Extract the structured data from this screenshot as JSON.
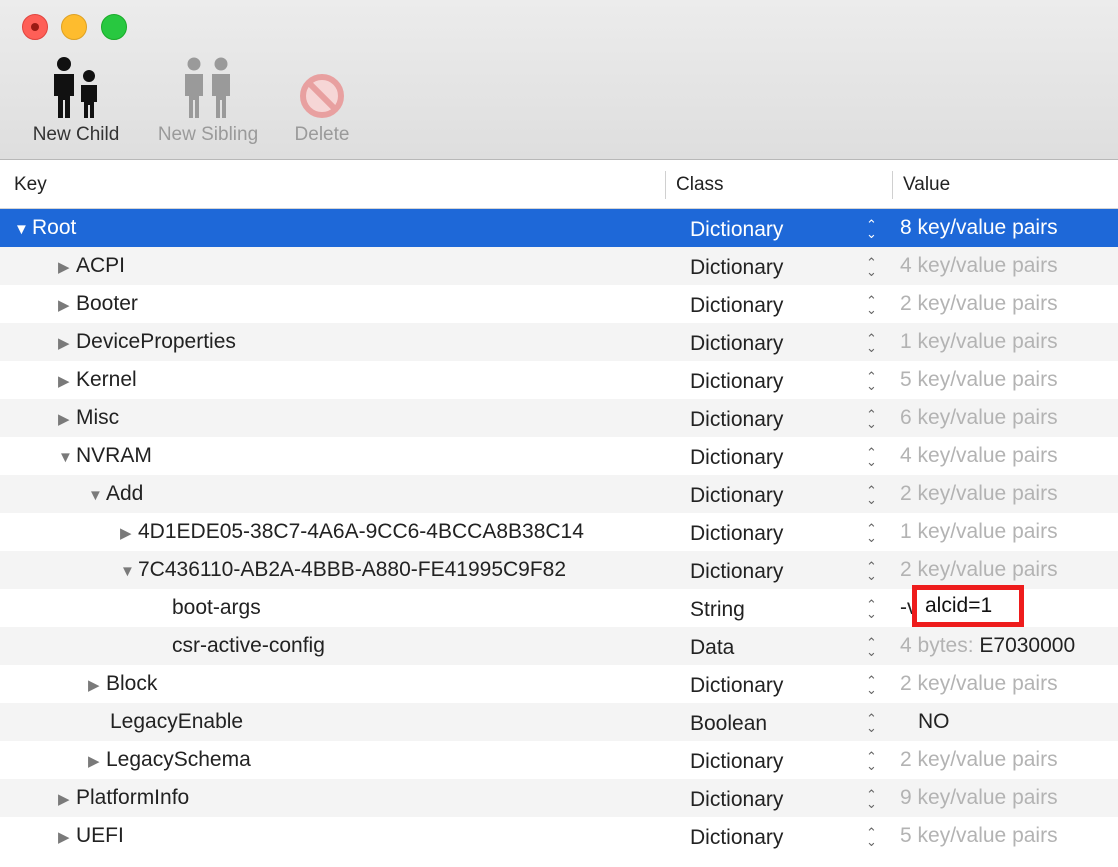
{
  "toolbar": {
    "new_child": "New Child",
    "new_sibling": "New Sibling",
    "delete": "Delete"
  },
  "columns": {
    "key": "Key",
    "class": "Class",
    "value": "Value"
  },
  "rows": [
    {
      "key": "Root",
      "class": "Dictionary",
      "value": "8 key/value pairs"
    },
    {
      "key": "ACPI",
      "class": "Dictionary",
      "value": "4 key/value pairs"
    },
    {
      "key": "Booter",
      "class": "Dictionary",
      "value": "2 key/value pairs"
    },
    {
      "key": "DeviceProperties",
      "class": "Dictionary",
      "value": "1 key/value pairs"
    },
    {
      "key": "Kernel",
      "class": "Dictionary",
      "value": "5 key/value pairs"
    },
    {
      "key": "Misc",
      "class": "Dictionary",
      "value": "6 key/value pairs"
    },
    {
      "key": "NVRAM",
      "class": "Dictionary",
      "value": "4 key/value pairs"
    },
    {
      "key": "Add",
      "class": "Dictionary",
      "value": "2 key/value pairs"
    },
    {
      "key": "4D1EDE05-38C7-4A6A-9CC6-4BCCA8B38C14",
      "class": "Dictionary",
      "value": "1 key/value pairs"
    },
    {
      "key": "7C436110-AB2A-4BBB-A880-FE41995C9F82",
      "class": "Dictionary",
      "value": "2 key/value pairs"
    },
    {
      "key": "boot-args",
      "class": "String",
      "value_prefix": "-v",
      "value_highlight": "alcid=1"
    },
    {
      "key": "csr-active-config",
      "class": "Data",
      "value_dim": "4 bytes:",
      "value_dark": "E7030000"
    },
    {
      "key": "Block",
      "class": "Dictionary",
      "value": "2 key/value pairs"
    },
    {
      "key": "LegacyEnable",
      "class": "Boolean",
      "value": "NO"
    },
    {
      "key": "LegacySchema",
      "class": "Dictionary",
      "value": "2 key/value pairs"
    },
    {
      "key": "PlatformInfo",
      "class": "Dictionary",
      "value": "9 key/value pairs"
    },
    {
      "key": "UEFI",
      "class": "Dictionary",
      "value": "5 key/value pairs"
    }
  ],
  "icons": {
    "disclosure_open": "▼",
    "disclosure_closed": "▶",
    "stepper": "⌃⌄"
  }
}
